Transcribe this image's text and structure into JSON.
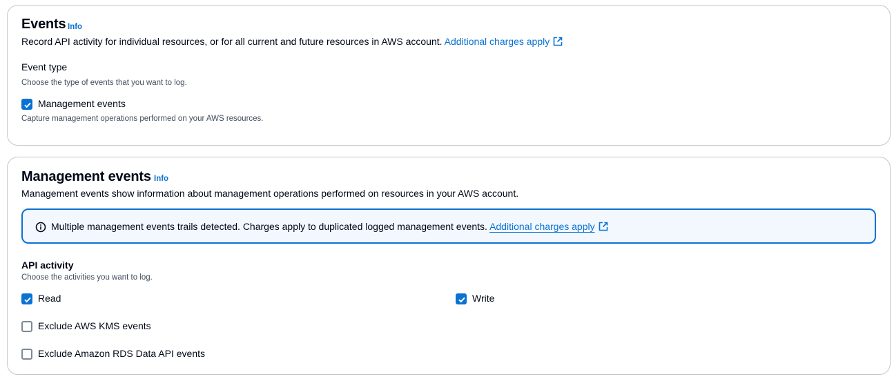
{
  "events_panel": {
    "title": "Events",
    "info_label": "Info",
    "description": "Record API activity for individual resources, or for all current and future resources in AWS account.",
    "charges_link": "Additional charges apply",
    "event_type": {
      "label": "Event type",
      "hint": "Choose the type of events that you want to log."
    },
    "management_events_option": {
      "label": "Management events",
      "checked": true,
      "description": "Capture management operations performed on your AWS resources."
    }
  },
  "management_panel": {
    "title": "Management events",
    "info_label": "Info",
    "description": "Management events show information about management operations performed on resources in your AWS account.",
    "alert": {
      "text": "Multiple management events trails detected. Charges apply to duplicated logged management events.",
      "link": "Additional charges apply",
      "icon": "info-circle-icon"
    },
    "api_activity": {
      "label": "API activity",
      "hint": "Choose the activities you want to log.",
      "options": [
        {
          "label": "Read",
          "checked": true
        },
        {
          "label": "Write",
          "checked": true
        },
        {
          "label": "Exclude AWS KMS events",
          "checked": false
        },
        {
          "label": "Exclude Amazon RDS Data API events",
          "checked": false
        }
      ]
    }
  },
  "colors": {
    "accent": "#0972d3",
    "border": "#c6c6cd",
    "alert_bg": "#f2f8fd",
    "text": "#000716"
  }
}
